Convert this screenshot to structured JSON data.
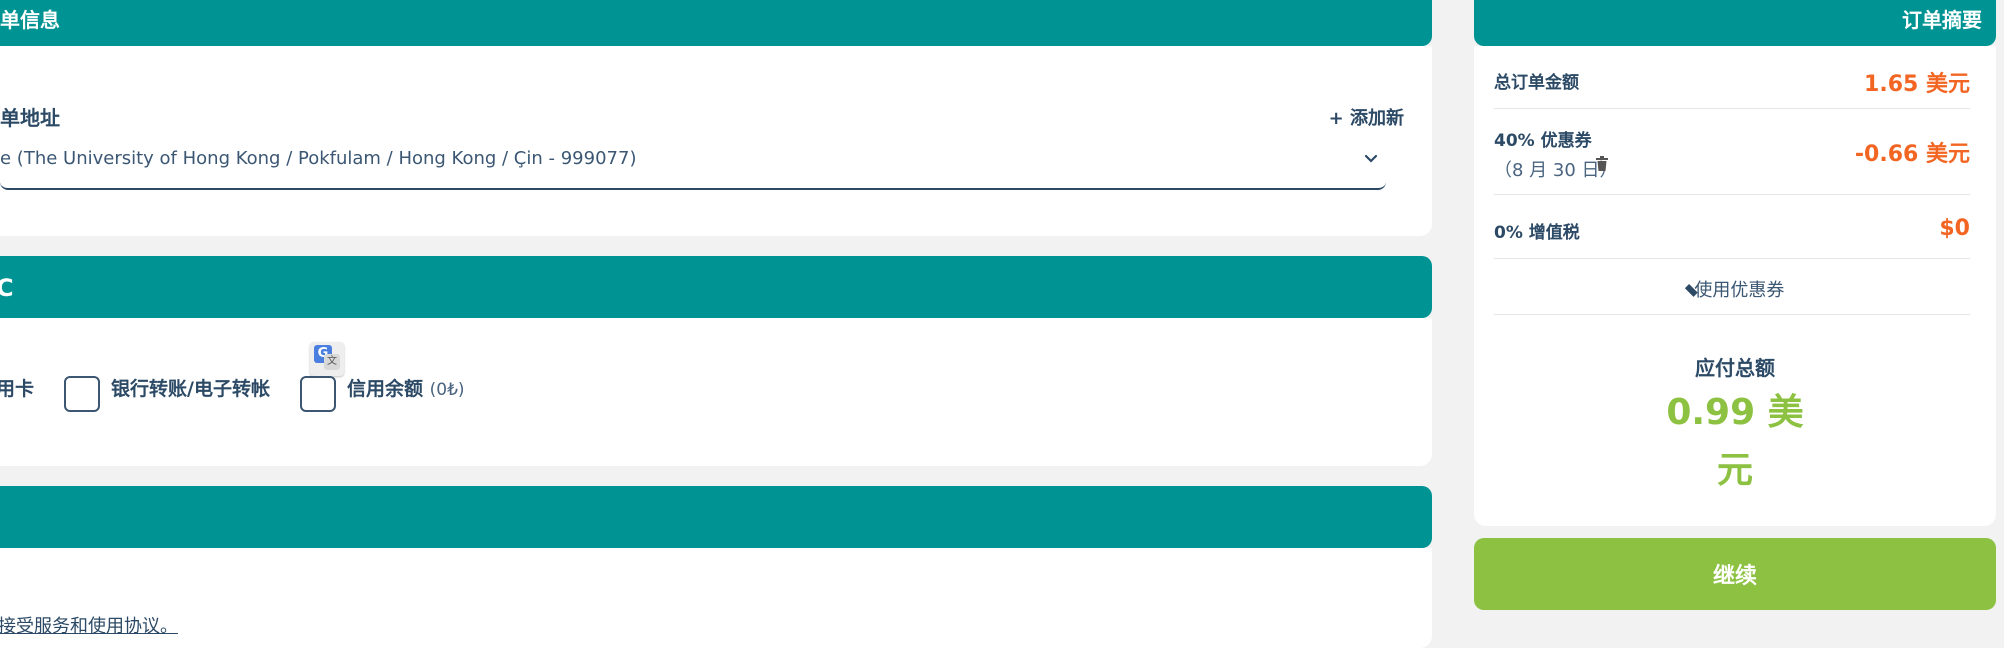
{
  "billing_section": {
    "title_fragment": "单信息",
    "address_label": "单地址",
    "add_new_label": "+ 添加新",
    "address_value": "e (The University of Hong Kong / Pokfulam / Hong Kong / Çin - 999077)"
  },
  "payment_section": {
    "title_fragment": "C",
    "options": [
      {
        "label": "用卡"
      },
      {
        "label": "银行转账/电子转帐"
      },
      {
        "label": "信用余额",
        "note": "(0₺)"
      }
    ]
  },
  "terms_section": {
    "terms_link_label": "接受服务和使用协议。"
  },
  "order_summary": {
    "title": "订单摘要",
    "total_order_label": "总订单金额",
    "total_order_value": "1.65 美元",
    "coupon_label": "40% 优惠券",
    "coupon_date": "（8 月 30 日）",
    "coupon_value": "-0.66 美元",
    "vat_label": "0% 增值税",
    "vat_value": "$0",
    "use_coupon_label": "使用优惠券",
    "amount_due_label": "应付总额",
    "amount_due_value": "0.99 美元"
  },
  "continue_label": "继续",
  "colors": {
    "teal": "#009393",
    "green": "#8cc142",
    "orange": "#f26522",
    "navy": "#2c4a66"
  }
}
